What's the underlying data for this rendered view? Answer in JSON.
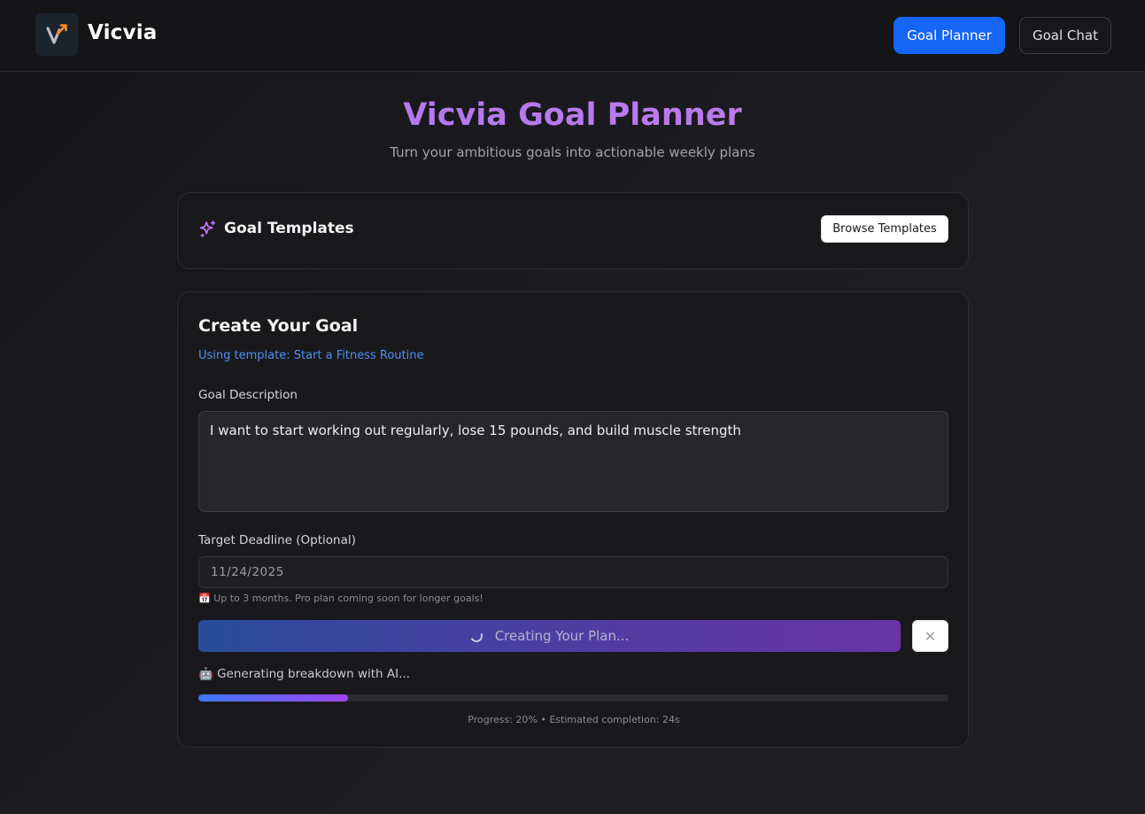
{
  "header": {
    "brand": "Vicvia",
    "nav": {
      "planner": "Goal Planner",
      "chat": "Goal Chat"
    },
    "accent": "#1565f7"
  },
  "hero": {
    "title": "Vicvia Goal Planner",
    "subtitle": "Turn your ambitious goals into actionable weekly plans"
  },
  "templates": {
    "icon": "sparkles-icon",
    "title": "Goal Templates",
    "browse_label": "Browse Templates"
  },
  "create": {
    "title": "Create Your Goal",
    "template_note": "Using template: Start a Fitness Routine",
    "description_label": "Goal Description",
    "description_value": "I want to start working out regularly, lose 15 pounds, and build muscle strength",
    "deadline_label": "Target Deadline (Optional)",
    "deadline_value": "11/24/2025",
    "hint": "📅 Up to 3 months. Pro plan coming soon for longer goals!",
    "submit_label": "Creating Your Plan...",
    "cancel_icon": "close-icon",
    "status": "🤖 Generating breakdown with AI...",
    "progress_fraction": 0.2,
    "progress_text": "Progress: 20% • Estimated completion: 24s"
  }
}
